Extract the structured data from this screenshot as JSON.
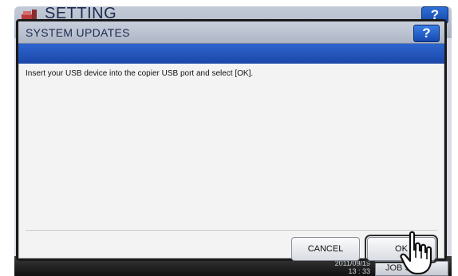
{
  "background_screen": {
    "title": "SETTING",
    "help_label": "?",
    "date": "2011/09/19",
    "time": "13 : 33",
    "job_status_label": "JOB ST"
  },
  "dialog": {
    "title": "SYSTEM UPDATES",
    "help_label": "?",
    "message": "Insert your USB device into the copier USB port and select [OK].",
    "buttons": {
      "cancel": "CANCEL",
      "ok": "OK"
    }
  },
  "icons": {
    "logo": "setting-logo-icon",
    "pointer": "hand-pointer-icon"
  },
  "colors": {
    "title_band_blue": "#1c47a8",
    "help_button_blue": "#1548ae",
    "dialog_border": "#1a1a1a",
    "dialog_body": "#f3f3f3"
  }
}
